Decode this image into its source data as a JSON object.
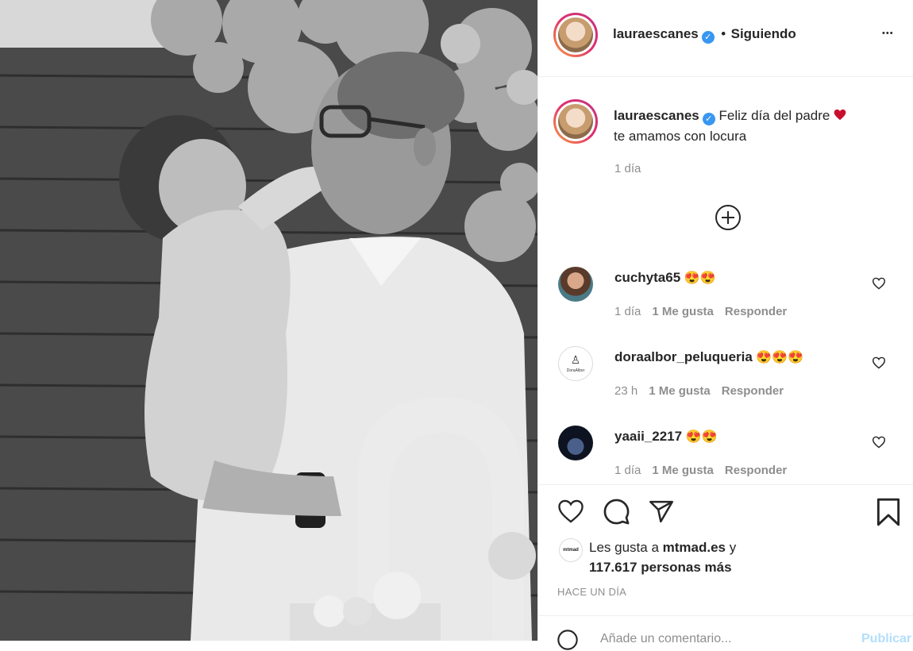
{
  "post": {
    "author": "lauraescanes",
    "follow_status": "Siguiendo",
    "follow_separator": "•",
    "more_menu": "•••",
    "caption_text": "Feliz día del padre",
    "caption_text_2": "te amamos con locura",
    "caption_time": "1 día",
    "load_more": "+"
  },
  "comments": [
    {
      "user": "cuchyta65",
      "emoji": "😍😍",
      "time": "1 día",
      "likes": "1 Me gusta",
      "reply": "Responder"
    },
    {
      "user": "doraalbor_peluqueria",
      "emoji": "😍😍😍",
      "time": "23 h",
      "likes": "1 Me gusta",
      "reply": "Responder",
      "avatar_text": "DoraAlbor"
    },
    {
      "user": "yaaii_2217",
      "emoji": "😍😍",
      "time": "1 día",
      "likes": "1 Me gusta",
      "reply": "Responder"
    }
  ],
  "likes": {
    "prefix": "Les gusta a ",
    "account": "mtmad.es",
    "suffix": " y",
    "others": "117.617 personas más",
    "avatar_text": "mtmad"
  },
  "timestamp": "HACE UN DÍA",
  "comment_box": {
    "placeholder": "Añade un comentario...",
    "post_button": "Publicar"
  },
  "colors": {
    "verified": "#3897f0",
    "heart": "#ed4956",
    "muted": "#8e8e8e",
    "text": "#262626"
  }
}
